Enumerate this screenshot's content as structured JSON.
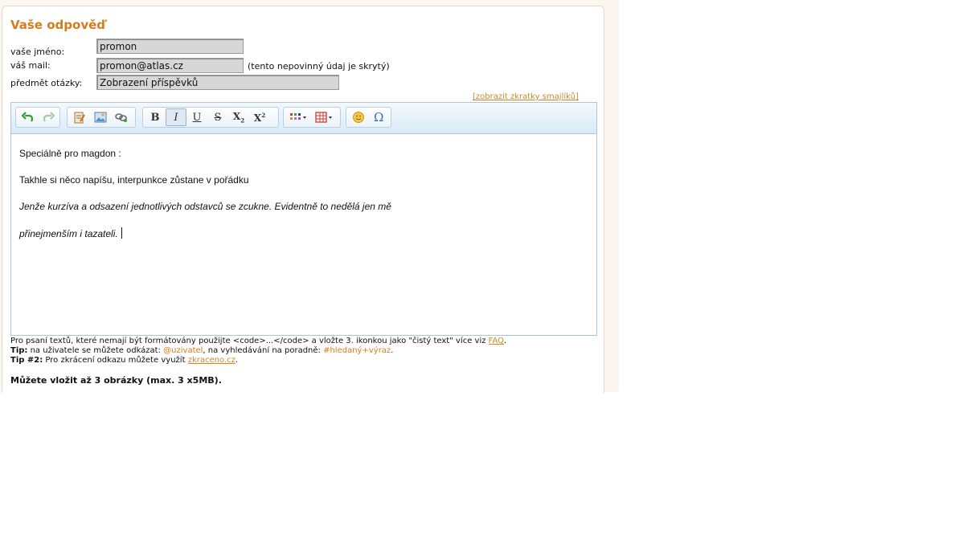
{
  "form": {
    "title": "Vaše odpověď",
    "name_label": "vaše jméno:",
    "name_value": "promon",
    "mail_label": "váš mail:",
    "mail_value": "promon@atlas.cz",
    "mail_hint": "(tento nepovinný údaj je skrytý)",
    "subject_label": "předmět otázky:",
    "subject_value": "Zobrazení příspěvků",
    "smiley_link": "[zobrazit zkratky smajlíků]"
  },
  "toolbar": {
    "bold": "B",
    "italic": "I",
    "underline": "U",
    "strike": "S",
    "sub_base": "X",
    "sub_mark": "2",
    "sup_base": "X",
    "sup_mark": "2",
    "omega": "Ω",
    "icons": [
      "undo-icon",
      "redo-icon",
      "paste-text-icon",
      "insert-image-icon",
      "insert-link-icon",
      "bold-icon",
      "italic-icon",
      "underline-icon",
      "strikethrough-icon",
      "subscript-icon",
      "superscript-icon",
      "list-icon",
      "table-icon",
      "smiley-icon",
      "special-char-icon"
    ]
  },
  "editor": {
    "line1": "Speciálně pro magdon :",
    "line2": "Takhle si něco napíšu, interpunkce zůstane v pořádku",
    "line3": "Jenže kurzíva a odsazení jednotlivých odstavců se zcukne. Evidentně to nedělá jen mě",
    "line4": "přinejmenším i tazateli."
  },
  "footer": {
    "line1_pre": "Pro psaní textů, které nemají být formátovány použijte <code>...</code> a vložte 3. ikonkou jako \"čistý text\" více viz ",
    "line1_link": "FAQ",
    "line1_post": ".",
    "tip1_label": "Tip:",
    "tip1_pre": " na uživatele se můžete odkázat: ",
    "tip1_user": "@uzivatel",
    "tip1_mid": ", na vyhledávání na poradně: ",
    "tip1_search": "#hledaný+výraz",
    "tip1_post": ".",
    "tip2_label": "Tip #2:",
    "tip2_pre": " Pro zkrácení odkazu můžete využít ",
    "tip2_link": "zkraceno.cz",
    "tip2_post": ".",
    "images_note": "Můžete vložit až 3 obrázky (max. 3 x5MB)."
  },
  "colors": {
    "accent": "#d77b1c",
    "link": "#c98a2a",
    "toolbar_border": "#a9c8de"
  }
}
